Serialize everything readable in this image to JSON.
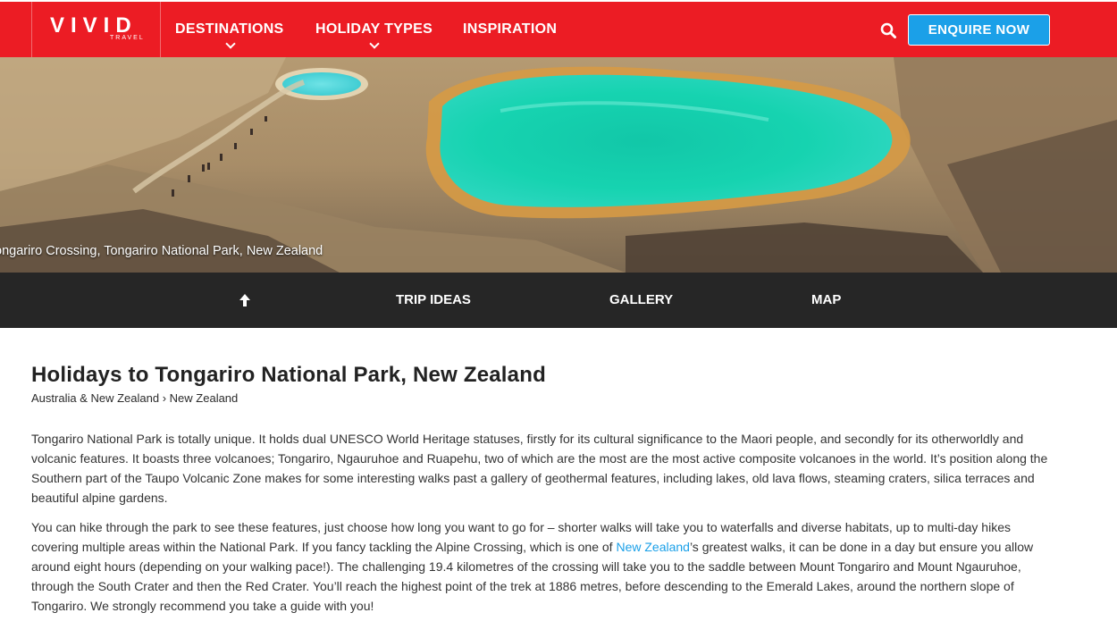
{
  "header": {
    "logo_main": "VIVID",
    "logo_sub": "TRAVEL",
    "nav": [
      {
        "label": "DESTINATIONS",
        "has_dropdown": true
      },
      {
        "label": "HOLIDAY TYPES",
        "has_dropdown": true
      },
      {
        "label": "INSPIRATION",
        "has_dropdown": false
      }
    ],
    "search_icon": "search-icon",
    "enquire_label": "ENQUIRE NOW"
  },
  "hero": {
    "caption": "ongariro Crossing, Tongariro National Park, New Zealand"
  },
  "subnav": {
    "back_to_top_icon": "arrow-up-icon",
    "items": [
      "TRIP IDEAS",
      "GALLERY",
      "MAP"
    ]
  },
  "main": {
    "title": "Holidays to Tongariro National Park, New Zealand",
    "breadcrumb": {
      "level1": "Australia & New Zealand",
      "separator": "›",
      "level2": "New Zealand"
    },
    "paragraph1": "Tongariro National Park is totally unique. It holds dual UNESCO World Heritage statuses, firstly for its cultural significance to the Maori people, and secondly for its otherworldly and volcanic features. It boasts three volcanoes; Tongariro, Ngauruhoe and Ruapehu, two of which are the most are the most active composite volcanoes in the world. It’s position along the Southern part of the Taupo Volcanic Zone makes for some interesting walks past a gallery of geothermal features, including lakes, old lava flows, steaming craters, silica terraces and beautiful alpine gardens.",
    "paragraph2": {
      "before_link": "You can hike through the park to see these features, just choose how long you want to go for – shorter walks will take you to waterfalls and diverse habitats, up to multi-day hikes covering multiple areas within the National Park. If you fancy tackling the Alpine Crossing, which is one of ",
      "link_text": "New Zealand",
      "after_link": "’s greatest walks, it can be done in a day but ensure you allow around eight hours (depending on your walking pace!). The challenging 19.4 kilometres of the crossing will take you to the saddle between Mount Tongariro and Mount Ngauruhoe, through the South Crater and then the Red Crater. You’ll reach the highest point of the trek at 1886 metres, before descending to the Emerald Lakes, around the northern slope of Tongariro. We strongly recommend you take a guide with you!"
    }
  },
  "colors": {
    "header_bg": "#ec1c24",
    "enquire_bg": "#1ba0e8",
    "subnav_bg": "#262626",
    "link": "#1ba0e8"
  }
}
